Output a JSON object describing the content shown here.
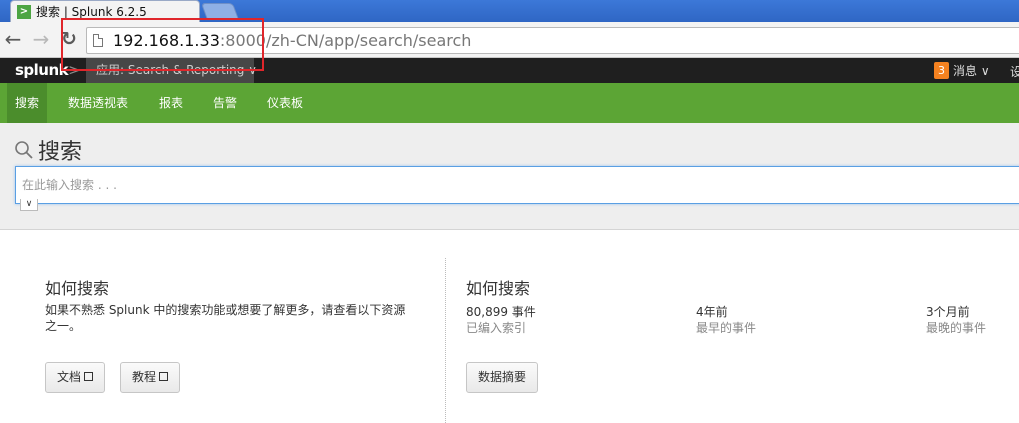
{
  "browser": {
    "tab_title": "搜索 | Splunk 6.2.5",
    "favicon": ">",
    "url_host": "192.168.1.33",
    "url_rest": ":8000/zh-CN/app/search/search"
  },
  "splunkbar": {
    "logo_text": "splunk",
    "logo_chevron": ">",
    "app_menu": "应用: Search & Reporting ∨",
    "messages_count": "3",
    "messages_label": "消息 ∨",
    "settings_partial": "设"
  },
  "appnav": {
    "items": [
      "搜索",
      "数据透视表",
      "报表",
      "告警",
      "仪表板"
    ]
  },
  "search": {
    "title": "搜索",
    "placeholder": "在此输入搜索 . . ."
  },
  "left_panel": {
    "title": "如何搜索",
    "description_line1": "如果不熟悉 Splunk 中的搜索功能或想要了解更多，请查看以下资源",
    "description_line2": "之一。",
    "doc_button": "文档",
    "tutorial_button": "教程"
  },
  "right_panel": {
    "title": "如何搜索",
    "stats": [
      {
        "value": "80,899 事件",
        "label": "已编入索引"
      },
      {
        "value": "4年前",
        "label": "最早的事件"
      },
      {
        "value": "3个月前",
        "label": "最晚的事件"
      }
    ],
    "summary_button": "数据摘要"
  },
  "colors": {
    "nav_green": "#5ca535",
    "splunkbar_bg": "#1f1f1f",
    "highlight_red": "#e0262b",
    "badge_orange": "#f58220"
  }
}
